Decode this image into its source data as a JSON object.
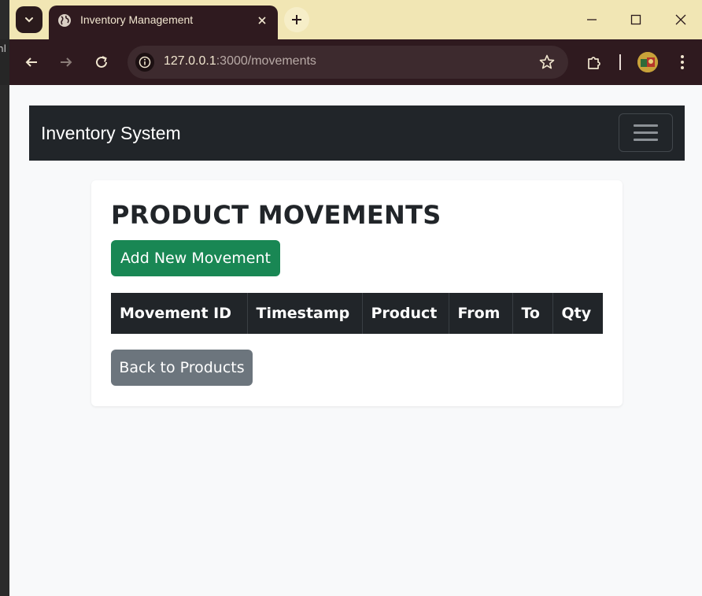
{
  "left_window": {
    "text": "nl"
  },
  "browser": {
    "tab": {
      "title": "Inventory Management"
    },
    "address": {
      "host": "127.0.0.1",
      "path": ":3000/movements"
    }
  },
  "page": {
    "brand": "Inventory System",
    "heading": "PRODUCT MOVEMENTS",
    "add_button": "Add New Movement",
    "table": {
      "columns": [
        "Movement ID",
        "Timestamp",
        "Product",
        "From",
        "To",
        "Qty"
      ],
      "rows": []
    },
    "back_button": "Back to Products"
  },
  "colors": {
    "tabbar": "#f1e6b4",
    "chrome": "#2f1a1f",
    "navbar": "#212529",
    "success": "#198754",
    "secondary": "#6c757d",
    "page_bg": "#f8f9fa"
  }
}
